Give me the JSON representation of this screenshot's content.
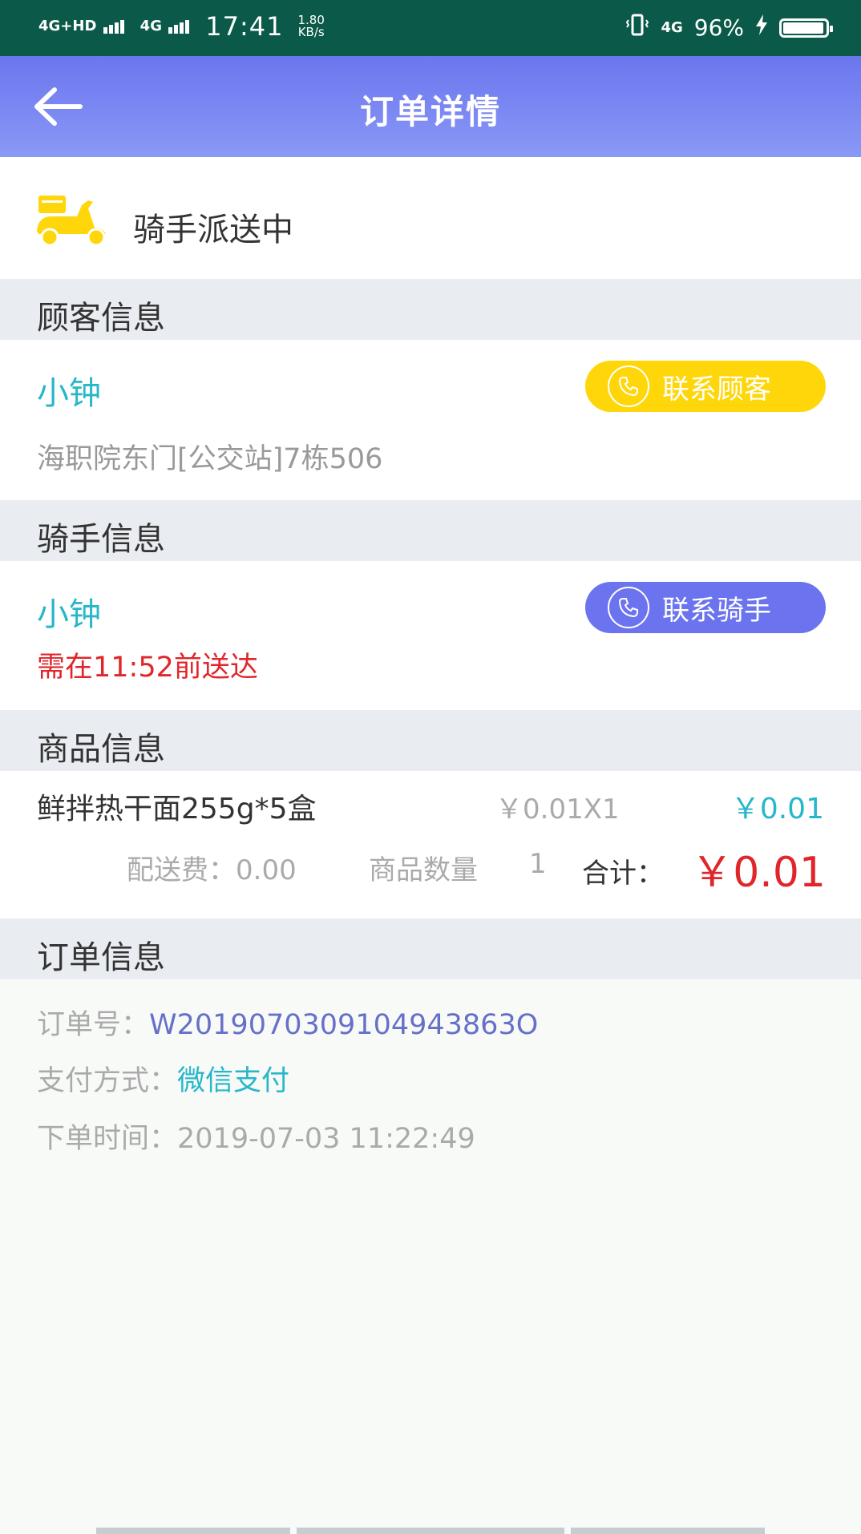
{
  "status_bar": {
    "signal1": "4G+HD",
    "signal2": "4G",
    "time": "17:41",
    "speed_value": "1.80",
    "speed_unit": "KB/s",
    "network": "4G",
    "battery": "96%",
    "battery_level": 0.96
  },
  "header": {
    "title": "订单详情",
    "back_icon": "arrow-left-icon"
  },
  "order_status": {
    "icon": "scooter-icon",
    "text": "骑手派送中",
    "icon_color": "#ffd60a"
  },
  "customer": {
    "section_title": "顾客信息",
    "name": "小钟",
    "address": "海职院东门[公交站]7栋506",
    "contact_label": "联系顾客"
  },
  "rider": {
    "section_title": "骑手信息",
    "name": "小钟",
    "deadline": "需在11:52前送达",
    "contact_label": "联系骑手"
  },
  "goods": {
    "section_title": "商品信息",
    "items": [
      {
        "name": "鲜拌热干面255g*5盒",
        "unit": "￥0.01X1",
        "price": "￥0.01"
      }
    ],
    "delivery_fee": "配送费：0.00",
    "quantity_label": "商品数量",
    "quantity": "1",
    "total_label": "合计：",
    "total": "￥0.01"
  },
  "order_info": {
    "section_title": "订单信息",
    "order_no_label": "订单号：",
    "order_no": "W2019070309104943863O",
    "payment_label": "支付方式：",
    "payment": "微信支付",
    "time_label": "下单时间：",
    "time": "2019-07-03 11:22:49"
  },
  "colors": {
    "header": "#6b76ee",
    "accent_teal": "#27b7c9",
    "warning_red": "#e0262b",
    "yellow_button": "#ffd60a",
    "blue_button": "#6b74ee"
  }
}
